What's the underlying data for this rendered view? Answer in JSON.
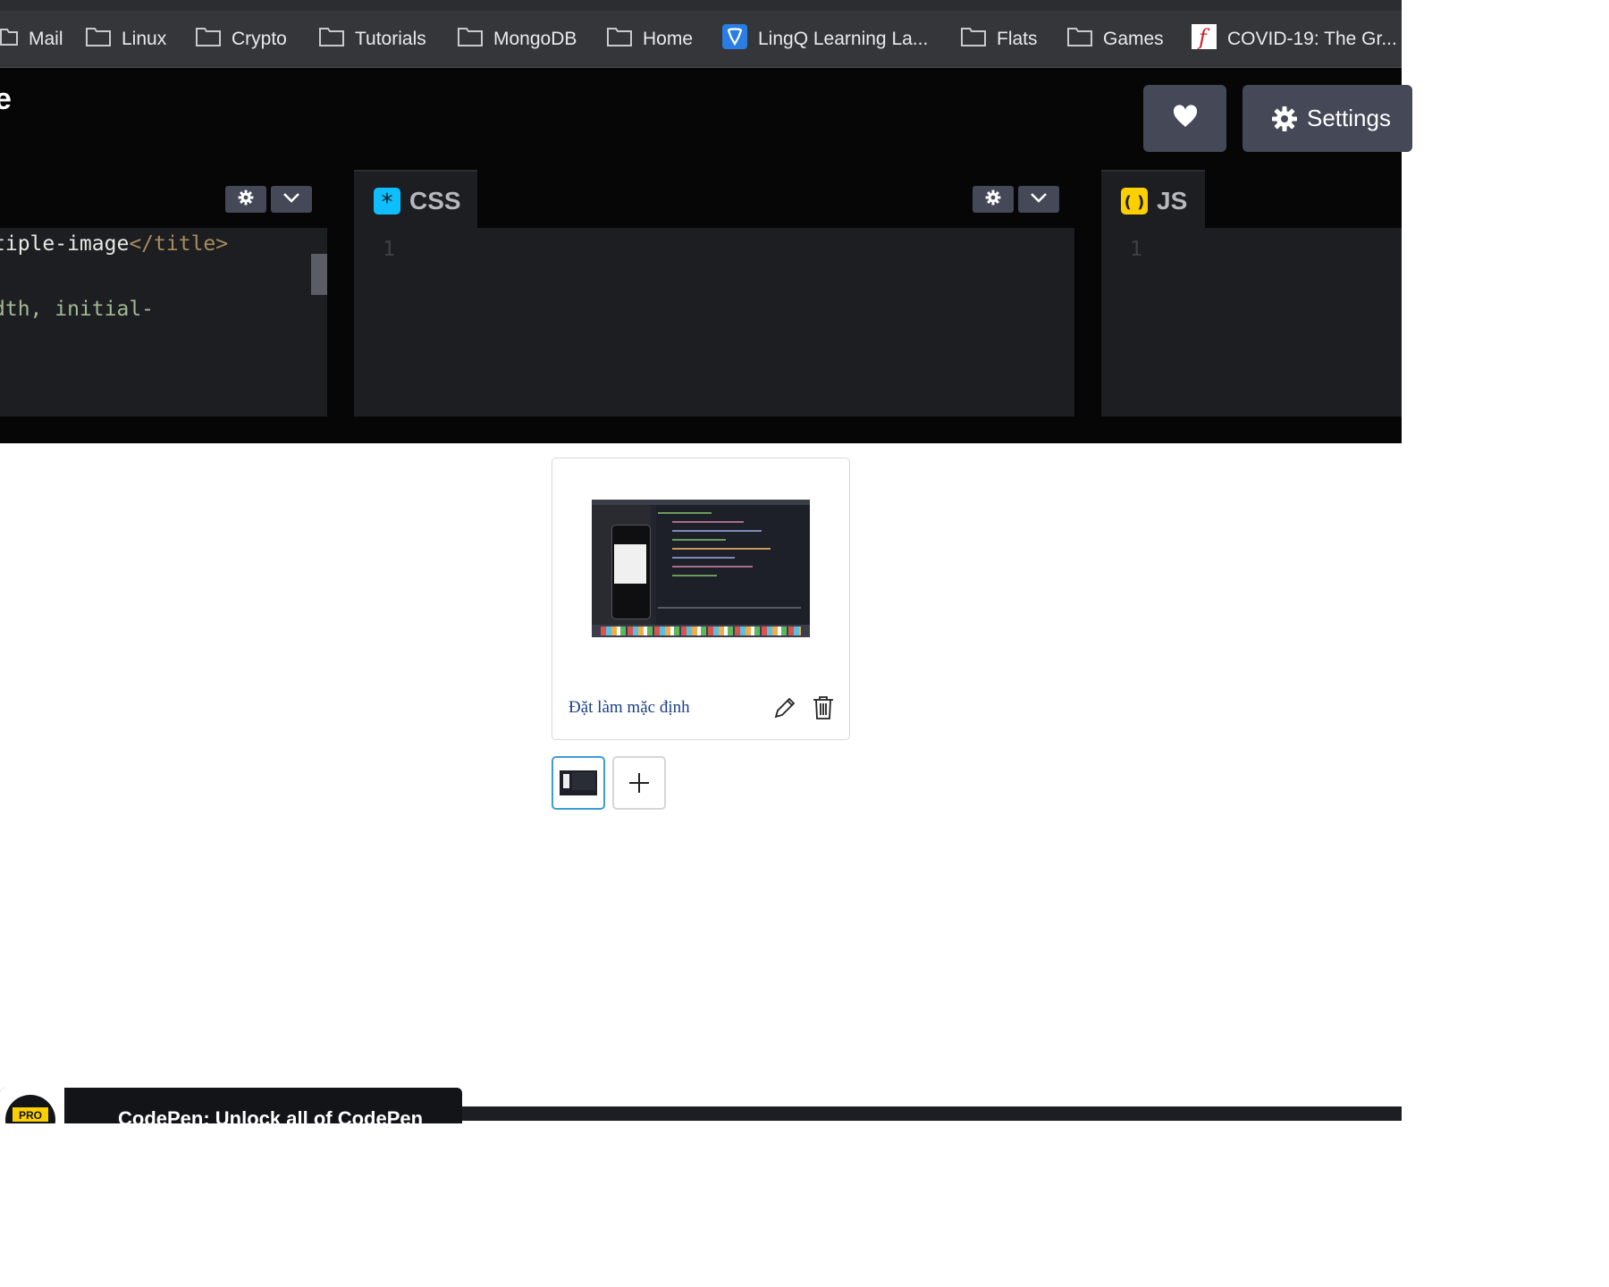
{
  "bookmarks": [
    {
      "label": "Mail",
      "icon": "folder-icon"
    },
    {
      "label": "Linux",
      "icon": "folder-icon"
    },
    {
      "label": "Crypto",
      "icon": "folder-icon"
    },
    {
      "label": "Tutorials",
      "icon": "folder-icon"
    },
    {
      "label": "MongoDB",
      "icon": "folder-icon"
    },
    {
      "label": "Home",
      "icon": "folder-icon"
    },
    {
      "label": "LingQ Learning La...",
      "icon": "lingq-icon"
    },
    {
      "label": "Flats",
      "icon": "folder-icon"
    },
    {
      "label": "Games",
      "icon": "folder-icon"
    },
    {
      "label": "COVID-19: The Gr...",
      "icon": "ft-icon"
    }
  ],
  "header": {
    "title_fragment": "e",
    "settings_label": "Settings"
  },
  "editors": {
    "html": {
      "code_lines": [
        {
          "parts": [
            {
              "text": "tiple-image",
              "color": "#e8e8e3"
            },
            {
              "text": "</title>",
              "color": "#a88b5c"
            }
          ]
        },
        {
          "parts": [
            {
              "text": "dth, initial-",
              "color": "#a3b892"
            }
          ]
        }
      ]
    },
    "css": {
      "label": "CSS",
      "line_number": "1"
    },
    "js": {
      "label": "JS",
      "line_number": "1"
    }
  },
  "preview": {
    "set_default_link": "Đặt làm mặc định"
  },
  "promo": {
    "badge": "PRO",
    "text": "CodePen: Unlock all of CodePen"
  },
  "colors": {
    "css_accent": "#0ebeff",
    "js_accent": "#fcd000",
    "link": "#1a3f8a",
    "selected_border": "#3d9bd8"
  }
}
